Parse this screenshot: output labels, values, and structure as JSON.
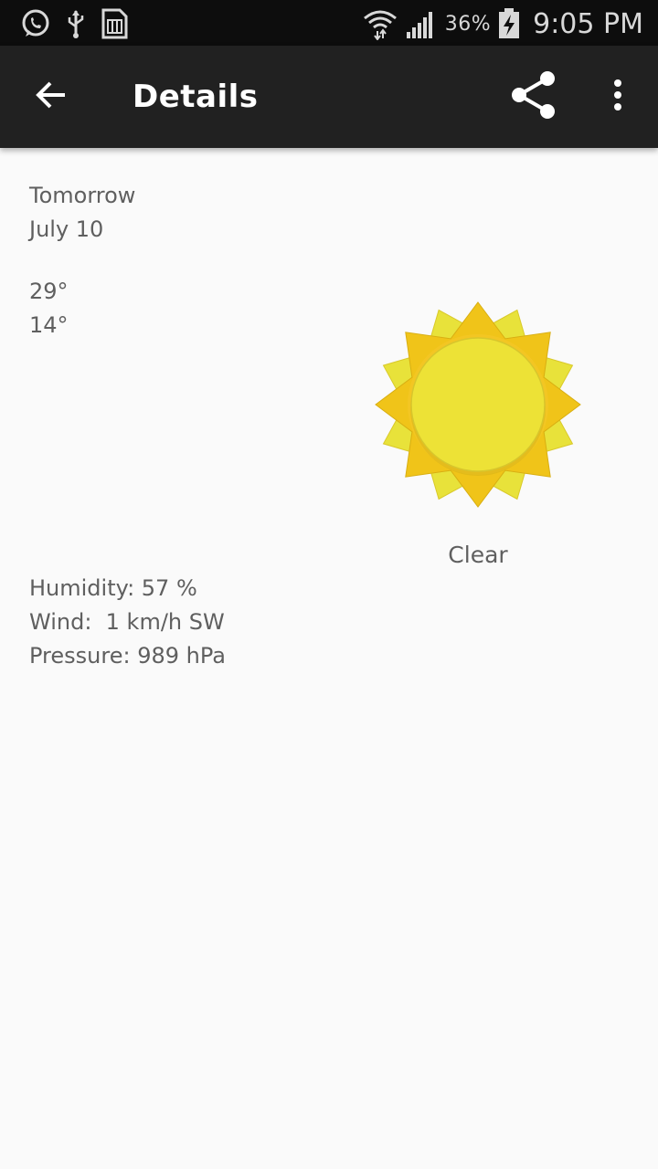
{
  "status_bar": {
    "left_icons": [
      "whatsapp-icon",
      "usb-icon",
      "sim-card-icon"
    ],
    "right_icons": [
      "wifi-icon",
      "signal-icon",
      "battery-charging-icon"
    ],
    "battery_percent": "36%",
    "time": "9:05 PM"
  },
  "app_bar": {
    "title": "Details",
    "back_icon": "arrow-back-icon",
    "share_icon": "share-icon",
    "overflow_icon": "more-vert-icon"
  },
  "details": {
    "day": "Tomorrow",
    "date": "July 10",
    "high": "29°",
    "low": "14°",
    "condition": "Clear",
    "condition_icon": "sun-icon",
    "humidity": "Humidity: 57 %",
    "wind": "Wind:  1 km/h SW",
    "pressure": "Pressure: 989 hPa"
  },
  "colors": {
    "status_bar": "#0d0d0d",
    "app_bar": "#212121",
    "background": "#fafafa",
    "text": "#5f5f5f",
    "sun_outer": "#f0c419",
    "sun_inner": "#ede236"
  }
}
